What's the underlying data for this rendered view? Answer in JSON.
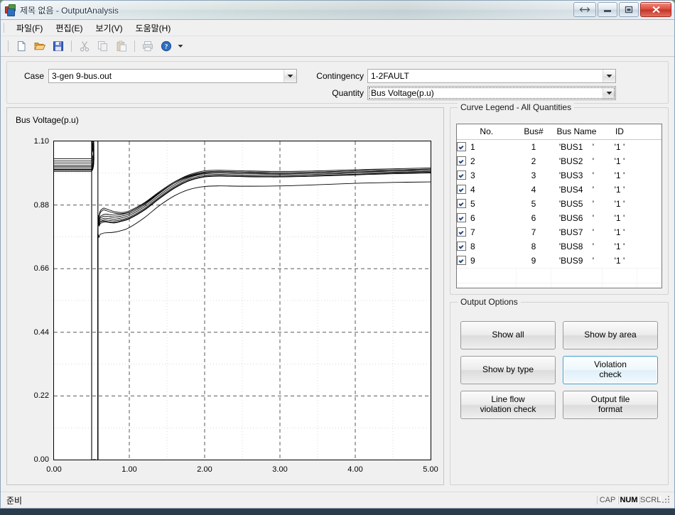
{
  "window": {
    "title": "제목 없음 - OutputAnalysis",
    "icon": "app-icon",
    "buttons": {
      "resize": "↔",
      "minimize": "—",
      "maximize": "▢",
      "close": "✕"
    }
  },
  "menu": {
    "items": [
      {
        "label": "파일(F)",
        "name": "menu-file"
      },
      {
        "label": "편집(E)",
        "name": "menu-edit"
      },
      {
        "label": "보기(V)",
        "name": "menu-view"
      },
      {
        "label": "도움말(H)",
        "name": "menu-help"
      }
    ]
  },
  "toolbar": {
    "items": [
      {
        "name": "new-icon",
        "label": "New",
        "enabled": true
      },
      {
        "name": "open-icon",
        "label": "Open",
        "enabled": true
      },
      {
        "name": "save-icon",
        "label": "Save",
        "enabled": true
      },
      {
        "name": "cut-icon",
        "label": "Cut",
        "enabled": false
      },
      {
        "name": "copy-icon",
        "label": "Copy",
        "enabled": false
      },
      {
        "name": "paste-icon",
        "label": "Paste",
        "enabled": false
      },
      {
        "name": "print-icon",
        "label": "Print",
        "enabled": false
      },
      {
        "name": "help-icon",
        "label": "Help",
        "enabled": true
      }
    ],
    "overflow_caret": "▾"
  },
  "selectors": {
    "case": {
      "label": "Case",
      "value": "3-gen 9-bus.out"
    },
    "contingency": {
      "label": "Contingency",
      "value": "1-2FAULT"
    },
    "quantity": {
      "label": "Quantity",
      "value": "Bus Voltage(p.u)",
      "focused": true
    }
  },
  "legend": {
    "caption": "Curve Legend - All Quantities",
    "columns": [
      "No.",
      "Bus#",
      "Bus Name",
      "ID"
    ],
    "rows": [
      {
        "no": "1",
        "bus": "1",
        "name": "'BUS1    '",
        "id": "'1 '",
        "checked": true
      },
      {
        "no": "2",
        "bus": "2",
        "name": "'BUS2    '",
        "id": "'1 '",
        "checked": true
      },
      {
        "no": "3",
        "bus": "3",
        "name": "'BUS3    '",
        "id": "'1 '",
        "checked": true
      },
      {
        "no": "4",
        "bus": "4",
        "name": "'BUS4    '",
        "id": "'1 '",
        "checked": true
      },
      {
        "no": "5",
        "bus": "5",
        "name": "'BUS5    '",
        "id": "'1 '",
        "checked": true
      },
      {
        "no": "6",
        "bus": "6",
        "name": "'BUS6    '",
        "id": "'1 '",
        "checked": true
      },
      {
        "no": "7",
        "bus": "7",
        "name": "'BUS7    '",
        "id": "'1 '",
        "checked": true
      },
      {
        "no": "8",
        "bus": "8",
        "name": "'BUS8    '",
        "id": "'1 '",
        "checked": true
      },
      {
        "no": "9",
        "bus": "9",
        "name": "'BUS9    '",
        "id": "'1 '",
        "checked": true
      }
    ]
  },
  "output_options": {
    "caption": "Output Options",
    "buttons": [
      {
        "label": "Show all",
        "name": "show-all-button",
        "highlighted": false
      },
      {
        "label": "Show by area",
        "name": "show-by-area-button",
        "highlighted": false
      },
      {
        "label": "Show by type",
        "name": "show-by-type-button",
        "highlighted": false
      },
      {
        "label": "Violation\ncheck",
        "name": "violation-check-button",
        "highlighted": true
      },
      {
        "label": "Line flow\nviolation check",
        "name": "line-flow-violation-check-button",
        "highlighted": false
      },
      {
        "label": "Output file\nformat",
        "name": "output-file-format-button",
        "highlighted": false
      }
    ]
  },
  "statusbar": {
    "message": "준비",
    "indicators": [
      {
        "label": "CAP",
        "active": false
      },
      {
        "label": "NUM",
        "active": true
      },
      {
        "label": "SCRL",
        "active": false
      }
    ]
  },
  "chart_data": {
    "type": "line",
    "title": "Bus Voltage(p.u)",
    "xlabel": "",
    "ylabel": "",
    "xlim": [
      0.0,
      5.0
    ],
    "ylim": [
      0.0,
      1.1
    ],
    "xticks": [
      "0.00",
      "1.00",
      "2.00",
      "3.00",
      "4.00",
      "5.00"
    ],
    "xtick_values": [
      0.0,
      1.0,
      2.0,
      3.0,
      4.0,
      5.0
    ],
    "yticks": [
      "0.00",
      "0.22",
      "0.44",
      "0.66",
      "0.88",
      "1.10"
    ],
    "ytick_values": [
      0.0,
      0.22,
      0.44,
      0.66,
      0.88,
      1.1
    ],
    "minor_gridlines": true,
    "grid": true,
    "legend_position": "external-right",
    "line_color": "#000000",
    "fault_start": 0.5,
    "fault_clear": 0.583,
    "series": [
      {
        "name": "'BUS1    '",
        "x": [
          0.0,
          0.49,
          0.5,
          0.5,
          0.52,
          0.55,
          0.583,
          0.583,
          0.6,
          0.65,
          0.7,
          0.8,
          0.9,
          1.0,
          1.2,
          1.4,
          1.6,
          1.8,
          2.0,
          2.2,
          2.5,
          3.0,
          3.5,
          4.0,
          4.5,
          5.0
        ],
        "y": [
          1.04,
          1.04,
          1.04,
          0.0,
          0.0,
          0.0,
          0.0,
          0.76,
          0.83,
          0.846,
          0.848,
          0.845,
          0.848,
          0.855,
          0.885,
          0.925,
          0.96,
          0.985,
          0.998,
          1.0,
          0.998,
          0.996,
          0.998,
          1.002,
          1.005,
          1.008
        ]
      },
      {
        "name": "'BUS2    '",
        "x": [
          0.0,
          0.49,
          0.5,
          0.5,
          0.52,
          0.55,
          0.583,
          0.583,
          0.6,
          0.65,
          0.7,
          0.8,
          0.9,
          1.0,
          1.2,
          1.4,
          1.6,
          1.8,
          2.0,
          2.2,
          2.5,
          3.0,
          3.5,
          4.0,
          4.5,
          5.0
        ],
        "y": [
          1.032,
          1.032,
          1.032,
          0.0,
          0.0,
          0.0,
          0.0,
          0.76,
          0.826,
          0.84,
          0.841,
          0.838,
          0.842,
          0.85,
          0.88,
          0.92,
          0.956,
          0.98,
          0.993,
          0.996,
          0.994,
          0.992,
          0.994,
          0.998,
          1.001,
          1.004
        ]
      },
      {
        "name": "'BUS3    '",
        "x": [
          0.0,
          0.49,
          0.5,
          0.5,
          0.52,
          0.55,
          0.583,
          0.583,
          0.6,
          0.65,
          0.7,
          0.8,
          0.9,
          1.0,
          1.2,
          1.4,
          1.6,
          1.8,
          2.0,
          2.2,
          2.5,
          3.0,
          3.5,
          4.0,
          4.5,
          5.0
        ],
        "y": [
          1.025,
          1.025,
          1.025,
          0.0,
          0.0,
          0.0,
          0.0,
          0.76,
          0.82,
          0.833,
          0.834,
          0.831,
          0.836,
          0.844,
          0.874,
          0.914,
          0.95,
          0.975,
          0.988,
          0.991,
          0.989,
          0.987,
          0.99,
          0.994,
          0.997,
          1.0
        ]
      },
      {
        "name": "'BUS4    '",
        "x": [
          0.0,
          0.49,
          0.5,
          0.5,
          0.52,
          0.55,
          0.583,
          0.583,
          0.6,
          0.65,
          0.7,
          0.8,
          0.9,
          1.0,
          1.2,
          1.4,
          1.6,
          1.8,
          2.0,
          2.2,
          2.5,
          3.0,
          3.5,
          4.0,
          4.5,
          5.0
        ],
        "y": [
          1.018,
          1.018,
          1.018,
          0.0,
          0.0,
          0.0,
          0.0,
          0.76,
          0.814,
          0.827,
          0.828,
          0.825,
          0.83,
          0.838,
          0.868,
          0.908,
          0.944,
          0.97,
          0.983,
          0.986,
          0.984,
          0.983,
          0.986,
          0.99,
          0.993,
          0.996
        ]
      },
      {
        "name": "'BUS5    '",
        "x": [
          0.0,
          0.49,
          0.5,
          0.5,
          0.52,
          0.55,
          0.583,
          0.583,
          0.6,
          0.65,
          0.7,
          0.8,
          0.9,
          1.0,
          1.2,
          1.4,
          1.6,
          1.8,
          2.0,
          2.2,
          2.5,
          3.0,
          3.5,
          4.0,
          4.5,
          5.0
        ],
        "y": [
          1.013,
          1.013,
          1.013,
          0.0,
          0.0,
          0.0,
          0.0,
          0.755,
          0.808,
          0.82,
          0.821,
          0.818,
          0.824,
          0.832,
          0.862,
          0.902,
          0.938,
          0.964,
          0.977,
          0.98,
          0.978,
          0.977,
          0.98,
          0.984,
          0.988,
          0.991
        ]
      },
      {
        "name": "'BUS6    '",
        "x": [
          0.0,
          0.49,
          0.5,
          0.5,
          0.52,
          0.55,
          0.583,
          0.583,
          0.6,
          0.65,
          0.7,
          0.8,
          0.9,
          1.0,
          1.2,
          1.4,
          1.6,
          1.8,
          2.0,
          2.2,
          2.5,
          3.0,
          3.5,
          4.0,
          4.5,
          5.0
        ],
        "y": [
          1.008,
          1.008,
          1.008,
          0.0,
          0.0,
          0.0,
          0.0,
          0.752,
          0.84,
          0.862,
          0.86,
          0.852,
          0.85,
          0.856,
          0.884,
          0.922,
          0.956,
          0.978,
          0.99,
          0.992,
          0.99,
          0.988,
          0.99,
          0.994,
          0.997,
          1.0
        ]
      },
      {
        "name": "'BUS7    '",
        "x": [
          0.0,
          0.49,
          0.5,
          0.5,
          0.52,
          0.55,
          0.583,
          0.583,
          0.6,
          0.65,
          0.7,
          0.8,
          0.9,
          1.0,
          1.2,
          1.4,
          1.6,
          1.8,
          2.0,
          2.2,
          2.5,
          3.0,
          3.5,
          4.0,
          4.5,
          5.0
        ],
        "y": [
          1.003,
          1.003,
          1.003,
          0.0,
          0.0,
          0.0,
          0.0,
          0.75,
          0.845,
          0.868,
          0.866,
          0.857,
          0.854,
          0.86,
          0.888,
          0.926,
          0.96,
          0.982,
          0.994,
          0.996,
          0.994,
          0.992,
          0.994,
          0.998,
          1.001,
          1.004
        ]
      },
      {
        "name": "'BUS8    '",
        "x": [
          0.0,
          0.49,
          0.5,
          0.5,
          0.52,
          0.55,
          0.583,
          0.583,
          0.6,
          0.65,
          0.7,
          0.8,
          0.9,
          1.0,
          1.2,
          1.4,
          1.6,
          1.8,
          2.0,
          2.2,
          2.5,
          3.0,
          3.5,
          4.0,
          4.5,
          5.0
        ],
        "y": [
          1.0,
          1.0,
          1.0,
          0.0,
          0.0,
          0.0,
          0.0,
          0.745,
          0.812,
          0.824,
          0.823,
          0.82,
          0.826,
          0.834,
          0.864,
          0.904,
          0.94,
          0.966,
          0.979,
          0.982,
          0.98,
          0.979,
          0.982,
          0.986,
          0.99,
          0.993
        ]
      },
      {
        "name": "'BUS9    '",
        "x": [
          0.0,
          0.49,
          0.5,
          0.5,
          0.52,
          0.55,
          0.583,
          0.583,
          0.6,
          0.65,
          0.7,
          0.8,
          0.9,
          1.0,
          1.2,
          1.4,
          1.6,
          1.8,
          2.0,
          2.2,
          2.5,
          3.0,
          3.5,
          4.0,
          4.5,
          5.0
        ],
        "y": [
          0.996,
          0.996,
          0.996,
          0.0,
          0.0,
          0.0,
          0.0,
          0.7,
          0.77,
          0.782,
          0.784,
          0.786,
          0.792,
          0.802,
          0.836,
          0.878,
          0.912,
          0.934,
          0.944,
          0.946,
          0.945,
          0.946,
          0.95,
          0.955,
          0.958,
          0.96
        ]
      }
    ]
  }
}
